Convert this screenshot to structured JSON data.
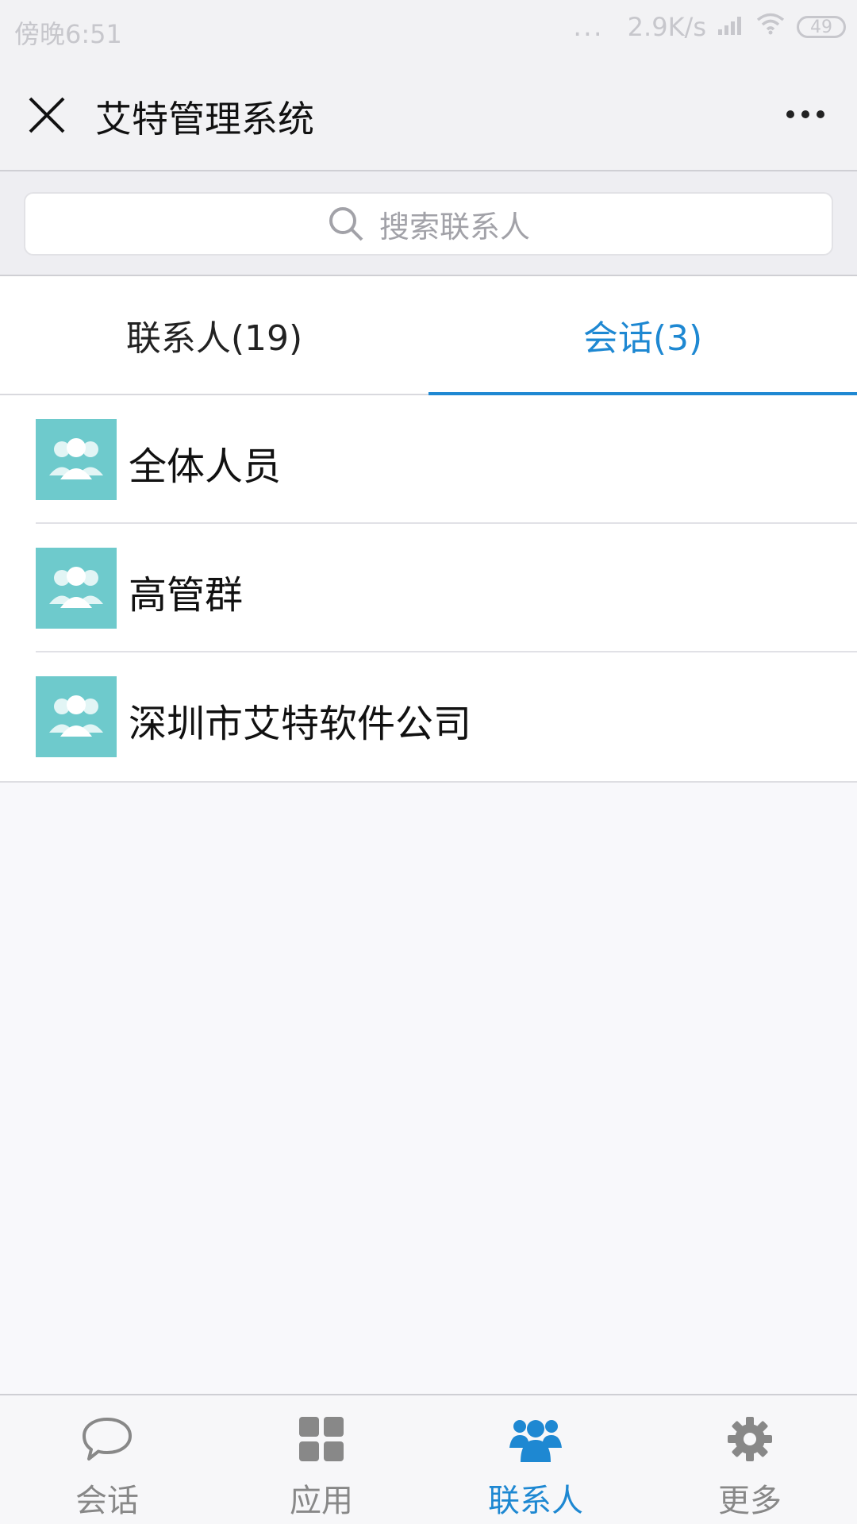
{
  "status_bar": {
    "time": "傍晚6:51",
    "dots": "...",
    "speed": "2.9K/s",
    "battery": "49"
  },
  "header": {
    "title": "艾特管理系统"
  },
  "search": {
    "placeholder": "搜索联系人"
  },
  "tabs": [
    {
      "label": "联系人(19)"
    },
    {
      "label": "会话(3)"
    }
  ],
  "groups": [
    {
      "name": "全体人员"
    },
    {
      "name": "高管群"
    },
    {
      "name": "深圳市艾特软件公司"
    }
  ],
  "bottom_nav": [
    {
      "label": "会话",
      "icon": "chat-bubble-icon"
    },
    {
      "label": "应用",
      "icon": "grid-apps-icon"
    },
    {
      "label": "联系人",
      "icon": "contacts-people-icon"
    },
    {
      "label": "更多",
      "icon": "gear-icon"
    }
  ],
  "colors": {
    "accent": "#1e88d2",
    "avatar": "#6ecacc",
    "inactive": "#888888"
  }
}
